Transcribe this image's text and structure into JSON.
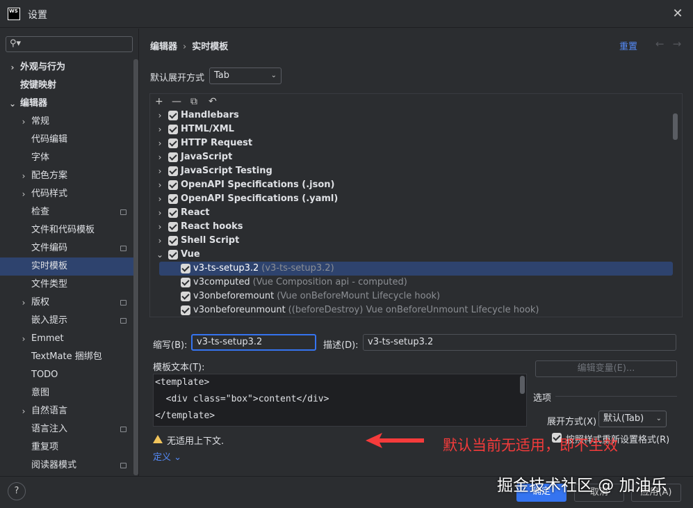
{
  "window": {
    "app_icon_text": "WS",
    "title": "设置",
    "close_icon": "close-icon"
  },
  "sidebar": {
    "search_placeholder": "",
    "items": [
      {
        "label": "外观与行为",
        "chevron": "›",
        "bold": true,
        "pinned": false
      },
      {
        "label": "按键映射",
        "chevron": "",
        "bold": true,
        "pinned": false
      },
      {
        "label": "编辑器",
        "chevron": "⌄",
        "bold": true,
        "pinned": false
      },
      {
        "label": "常规",
        "chevron": "›",
        "bold": false,
        "pinned": false
      },
      {
        "label": "代码编辑",
        "chevron": "",
        "bold": false,
        "pinned": false
      },
      {
        "label": "字体",
        "chevron": "",
        "bold": false,
        "pinned": false
      },
      {
        "label": "配色方案",
        "chevron": "›",
        "bold": false,
        "pinned": false
      },
      {
        "label": "代码样式",
        "chevron": "›",
        "bold": false,
        "pinned": false
      },
      {
        "label": "检查",
        "chevron": "",
        "bold": false,
        "pinned": true
      },
      {
        "label": "文件和代码模板",
        "chevron": "",
        "bold": false,
        "pinned": false
      },
      {
        "label": "文件编码",
        "chevron": "",
        "bold": false,
        "pinned": true
      },
      {
        "label": "实时模板",
        "chevron": "",
        "bold": false,
        "pinned": false,
        "selected": true
      },
      {
        "label": "文件类型",
        "chevron": "",
        "bold": false,
        "pinned": false
      },
      {
        "label": "版权",
        "chevron": "›",
        "bold": false,
        "pinned": true
      },
      {
        "label": "嵌入提示",
        "chevron": "",
        "bold": false,
        "pinned": true
      },
      {
        "label": "Emmet",
        "chevron": "›",
        "bold": false,
        "pinned": false
      },
      {
        "label": "TextMate 捆绑包",
        "chevron": "",
        "bold": false,
        "pinned": false
      },
      {
        "label": "TODO",
        "chevron": "",
        "bold": false,
        "pinned": false
      },
      {
        "label": "意图",
        "chevron": "",
        "bold": false,
        "pinned": false
      },
      {
        "label": "自然语言",
        "chevron": "›",
        "bold": false,
        "pinned": false
      },
      {
        "label": "语言注入",
        "chevron": "",
        "bold": false,
        "pinned": true
      },
      {
        "label": "重复项",
        "chevron": "",
        "bold": false,
        "pinned": false
      },
      {
        "label": "阅读器模式",
        "chevron": "",
        "bold": false,
        "pinned": true
      }
    ]
  },
  "breadcrumb": {
    "parent": "编辑器",
    "separator": "›",
    "current": "实时模板"
  },
  "header_actions": {
    "reset_label": "重置",
    "back_arrow": "←",
    "forward_arrow": "→"
  },
  "expand_default": {
    "label": "默认展开方式",
    "value": "Tab"
  },
  "toolbar": {
    "add": "+",
    "remove": "—",
    "copy": "⧉",
    "restore": "↶"
  },
  "groups": [
    {
      "name": "Handlebars",
      "expanded": false
    },
    {
      "name": "HTML/XML",
      "expanded": false
    },
    {
      "name": "HTTP Request",
      "expanded": false
    },
    {
      "name": "JavaScript",
      "expanded": false
    },
    {
      "name": "JavaScript Testing",
      "expanded": false
    },
    {
      "name": "OpenAPI Specifications (.json)",
      "expanded": false
    },
    {
      "name": "OpenAPI Specifications (.yaml)",
      "expanded": false
    },
    {
      "name": "React",
      "expanded": false
    },
    {
      "name": "React hooks",
      "expanded": false
    },
    {
      "name": "Shell Script",
      "expanded": false
    },
    {
      "name": "Vue",
      "expanded": true
    }
  ],
  "templates": [
    {
      "abbr": "v3-ts-setup3.2",
      "desc": "(v3-ts-setup3.2)",
      "selected": true
    },
    {
      "abbr": "v3computed",
      "desc": "(Vue Composition api - computed)",
      "selected": false
    },
    {
      "abbr": "v3onbeforemount",
      "desc": "(Vue onBeforeMount Lifecycle hook)",
      "selected": false
    },
    {
      "abbr": "v3onbeforeunmount",
      "desc": "((beforeDestroy) Vue onBeforeUnmount Lifecycle hook)",
      "selected": false
    }
  ],
  "editor": {
    "abbr_label": "缩写(B):",
    "abbr_value": "v3-ts-setup3.2",
    "desc_label": "描述(D):",
    "desc_value": "v3-ts-setup3.2",
    "template_text_label": "模板文本(T):",
    "code_lines": [
      "<template>",
      "  <div class=\"box\">content</div>",
      "</template>"
    ],
    "edit_vars_label": "编辑变量(E)...",
    "options_label": "选项",
    "expand_with_label": "展开方式(X)",
    "expand_with_value": "默认(Tab)",
    "reformat_label": "按照样式重新设置格式(R)",
    "warning_text": "无适用上下文.",
    "define_label": "定义 ⌄"
  },
  "annotation": {
    "text": "默认当前无适用，即不生效",
    "color": "#f53b3b"
  },
  "footer": {
    "help_label": "?",
    "ok_label": "确定",
    "cancel_label": "取消",
    "apply_label": "应用(A)"
  },
  "watermark": "掘金技术社区 @ 加油乐",
  "colors": {
    "accent": "#3574f0",
    "link": "#548af7",
    "selection": "#2e436e",
    "warning": "#f2c55c"
  }
}
